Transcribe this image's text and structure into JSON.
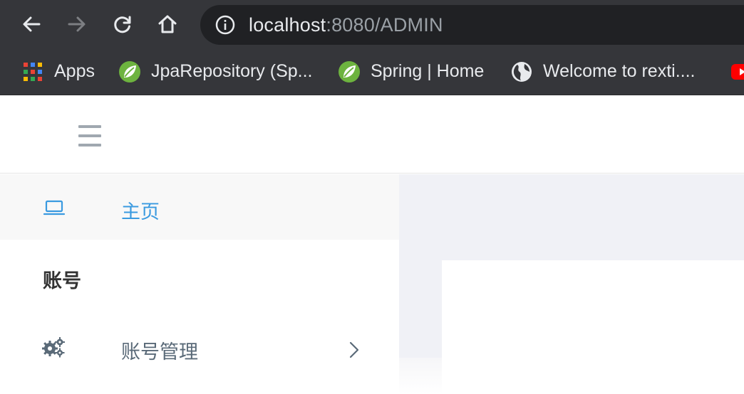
{
  "browser": {
    "url_host": "localhost",
    "url_rest": ":8080/ADMIN",
    "bookmarks": [
      {
        "label": "Apps",
        "icon": "apps-grid-icon"
      },
      {
        "label": "JpaRepository (Sp...",
        "icon": "spring-leaf-icon"
      },
      {
        "label": "Spring | Home",
        "icon": "spring-leaf-icon"
      },
      {
        "label": "Welcome to rexti....",
        "icon": "globe-icon"
      }
    ]
  },
  "colors": {
    "chrome_bg": "#35363a",
    "omnibox_bg": "#202124",
    "accent": "#3a9ae0",
    "content_bg": "#f0f1f6"
  },
  "sidebar": {
    "home": {
      "label": "主页",
      "icon": "laptop-icon"
    },
    "section_title": "账号",
    "items": [
      {
        "label": "账号管理",
        "icon": "gears-icon"
      }
    ]
  }
}
